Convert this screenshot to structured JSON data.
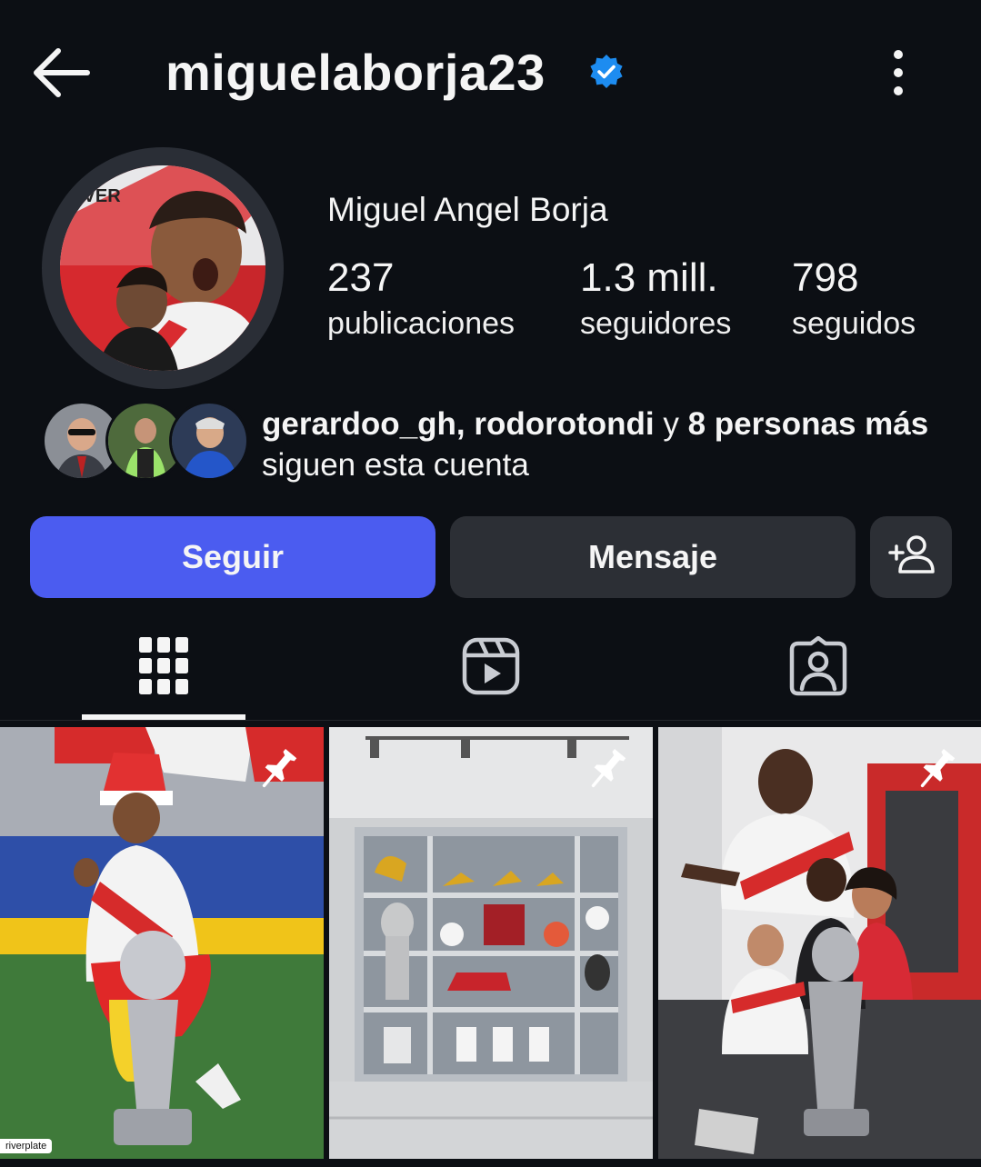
{
  "header": {
    "username": "miguelaborja23",
    "verified": true,
    "back_icon": "arrow-left-icon",
    "more_icon": "more-vertical-icon"
  },
  "profile": {
    "full_name": "Miguel Angel Borja",
    "stats": [
      {
        "value": "237",
        "label": "publicaciones"
      },
      {
        "value": "1.3 mill.",
        "label": "seguidores"
      },
      {
        "value": "798",
        "label": "seguidos"
      }
    ]
  },
  "followed_by": {
    "names": "gerardoo_gh, rodorotondi",
    "connector": " y ",
    "others": "8 personas más",
    "suffix": " siguen esta cuenta"
  },
  "actions": {
    "follow_label": "Seguir",
    "message_label": "Mensaje",
    "add_user_icon": "add-user-icon"
  },
  "tabs": [
    "grid-icon",
    "reels-icon",
    "tagged-icon"
  ],
  "posts": [
    {
      "pinned": true,
      "watermark": "riverplate"
    },
    {
      "pinned": true
    },
    {
      "pinned": true
    }
  ],
  "colors": {
    "background": "#0c0f14",
    "accent": "#4b5cf0",
    "verified": "#1d8cf0",
    "secondary_button": "#2c2f35"
  }
}
